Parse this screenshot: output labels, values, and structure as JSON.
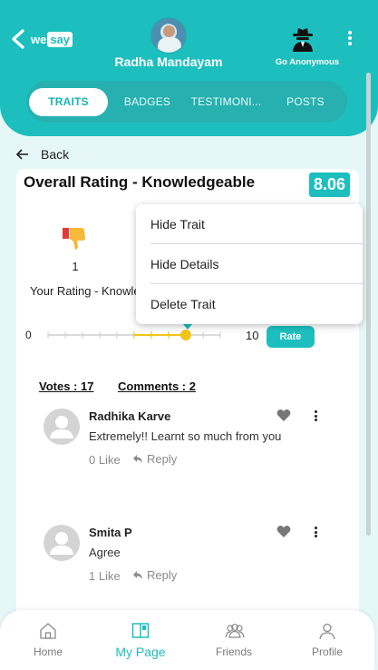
{
  "header": {
    "logo_we": "we",
    "logo_say": "say",
    "user_name": "Radha Mandayam",
    "anonymous_label": "Go Anonymous"
  },
  "tabs": [
    {
      "label": "TRAITS",
      "active": true
    },
    {
      "label": "BADGES",
      "active": false
    },
    {
      "label": "TESTIMONI...",
      "active": false
    },
    {
      "label": "POSTS",
      "active": false
    }
  ],
  "back_label": "Back",
  "trait": {
    "title": "Overall Rating - Knowledgeable",
    "score": "8.06",
    "your_count": "1",
    "your_rating_label": "Your Rating - Knowledgeable",
    "slider": {
      "min": "0",
      "max": "10",
      "value": 8
    },
    "rate_button": "Rate"
  },
  "stats": {
    "votes": "Votes : 17",
    "comments": "Comments : 2"
  },
  "comment_list": [
    {
      "name": "Radhika Karve",
      "text": "Extremely!! Learnt so much from you",
      "like": "0 Like",
      "reply": "Reply"
    },
    {
      "name": "Smita P",
      "text": "Agree",
      "like": "1 Like",
      "reply": "Reply"
    }
  ],
  "menu": {
    "items": [
      "Hide Trait",
      "Hide Details",
      "Delete Trait"
    ]
  },
  "bottom_nav": [
    {
      "label": "Home",
      "icon": "home-icon",
      "active": false
    },
    {
      "label": "My Page",
      "icon": "book-icon",
      "active": true
    },
    {
      "label": "Friends",
      "icon": "friends-icon",
      "active": false
    },
    {
      "label": "Profile",
      "icon": "person-icon",
      "active": false
    }
  ],
  "colors": {
    "accent": "#1dbfbe",
    "background": "#e6f7f7",
    "slider_fill": "#f0c419",
    "thumb_red": "#e53935",
    "thumb_yellow": "#f6b93b"
  }
}
